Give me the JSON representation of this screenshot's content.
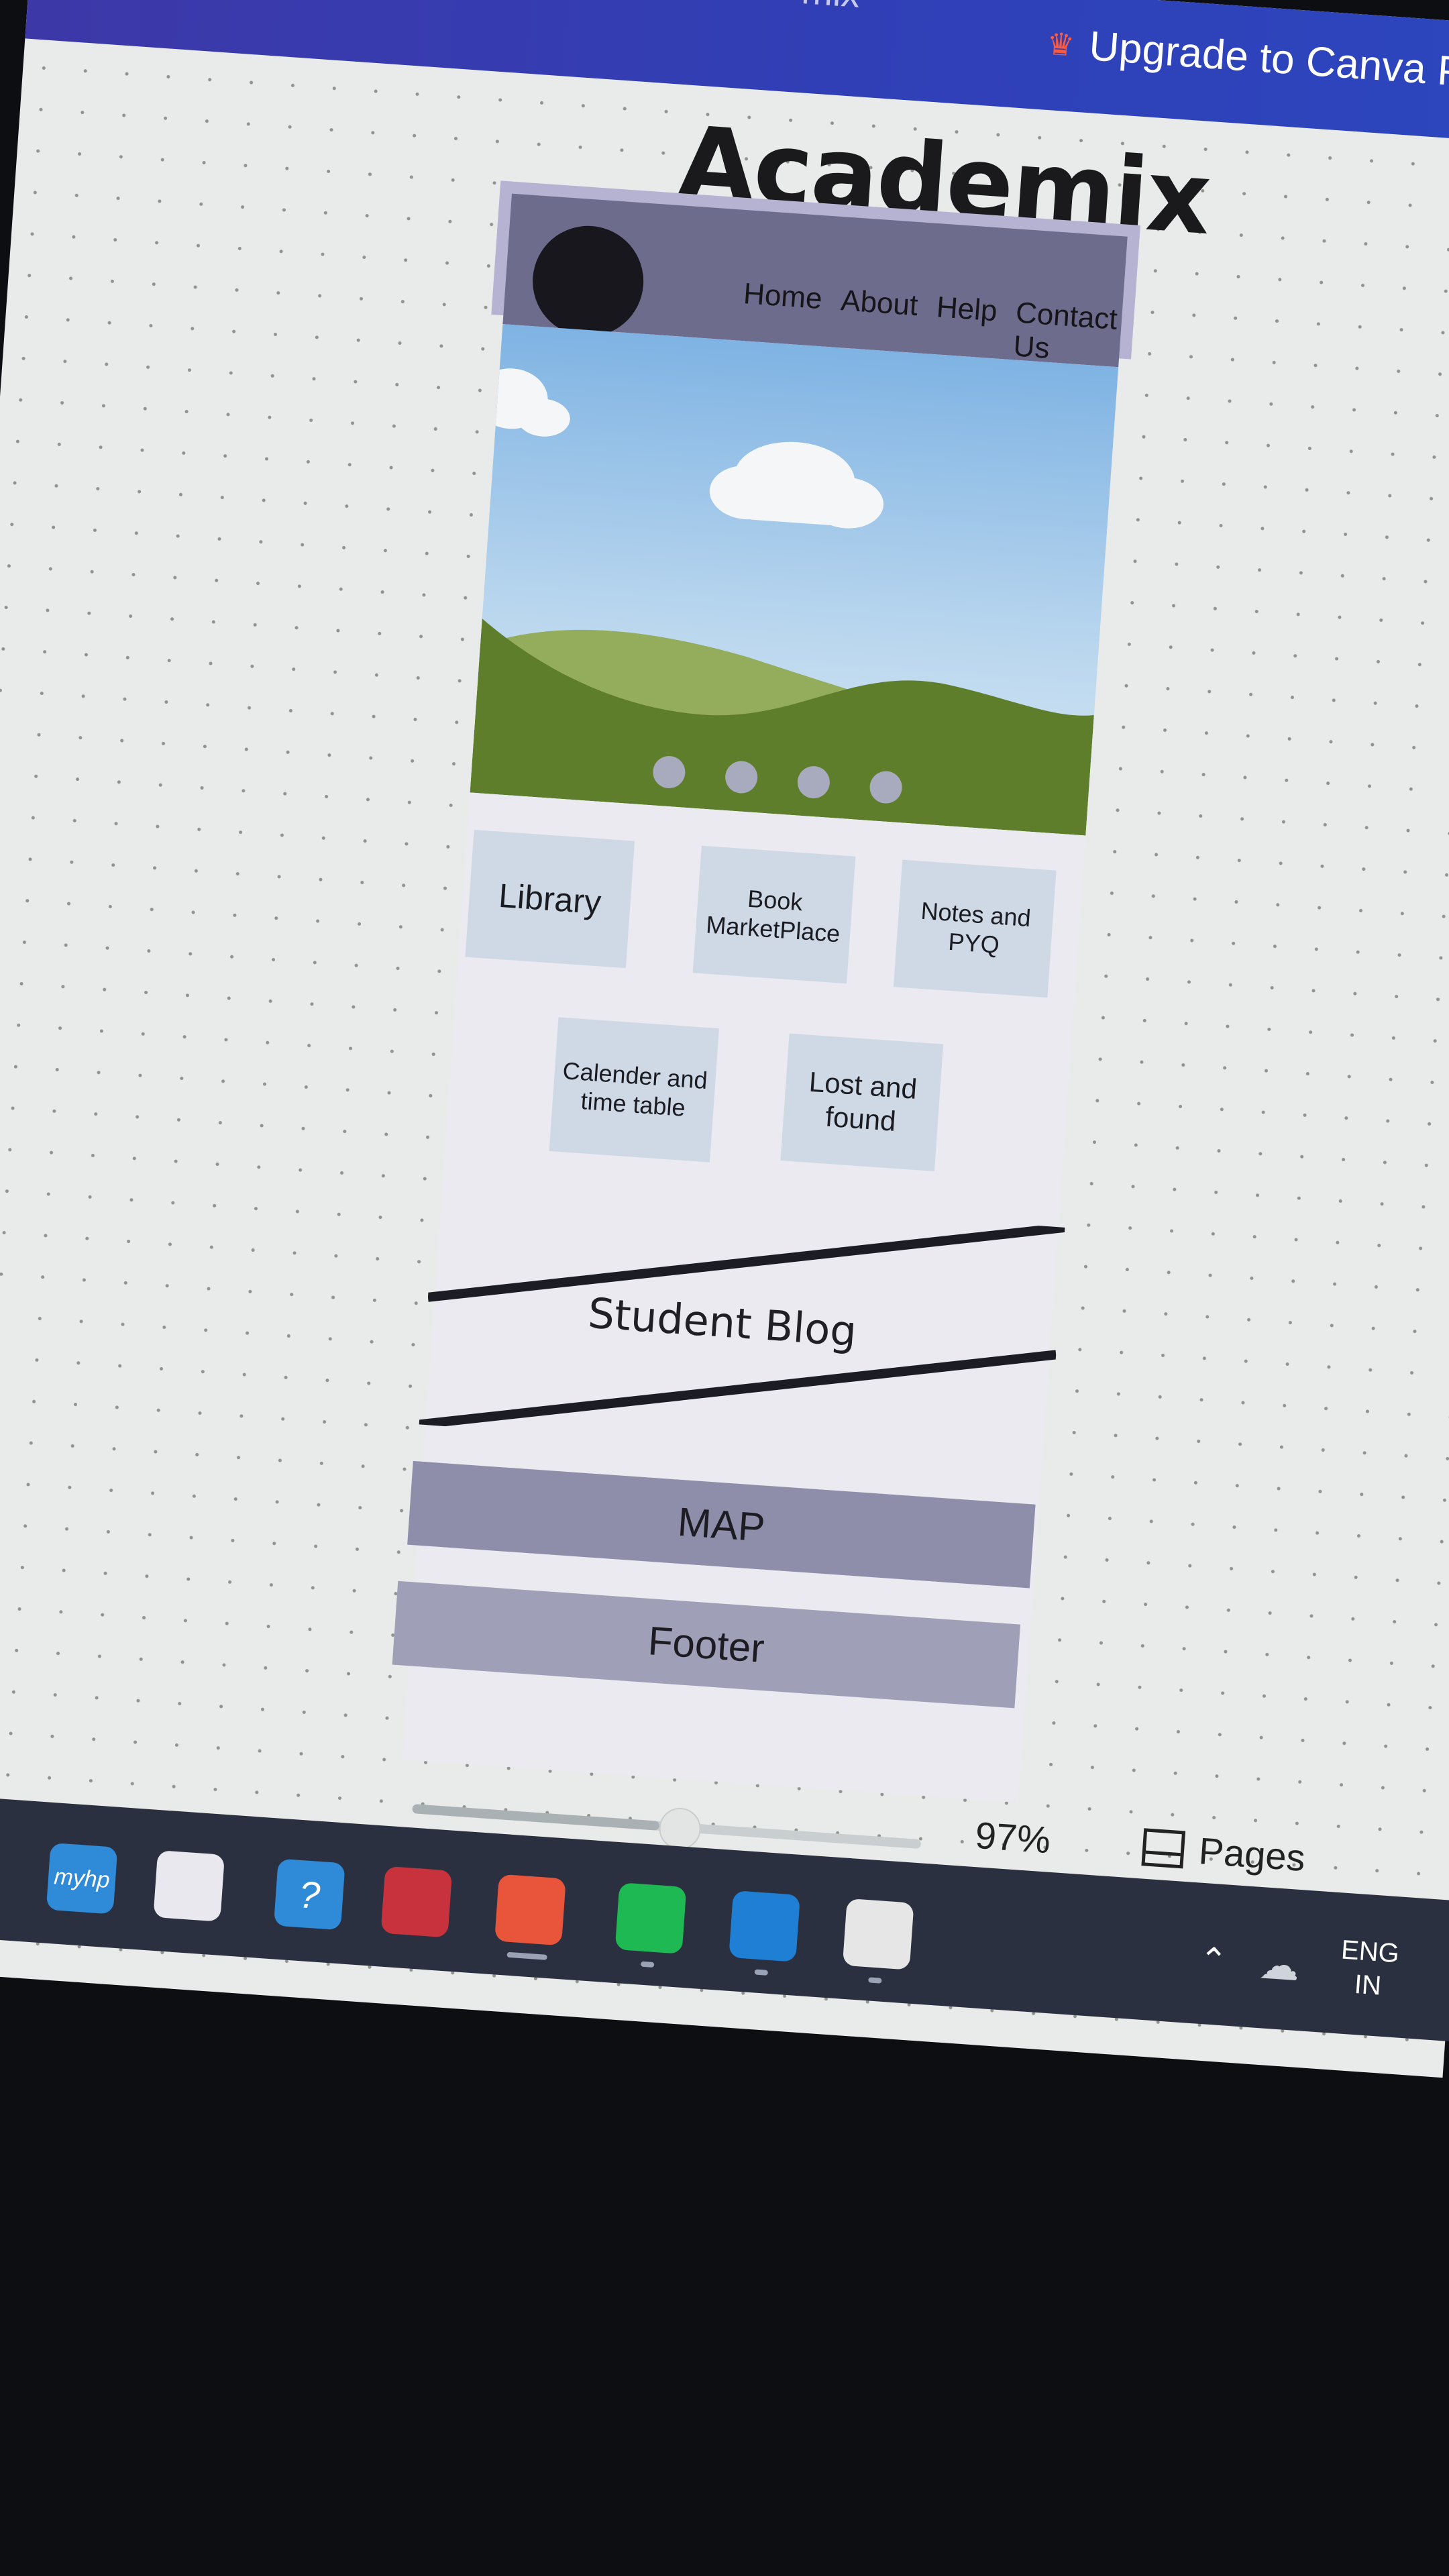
{
  "canva": {
    "window_title_fragment": "mix",
    "upgrade_label": "Upgrade to Canva Pro",
    "design_title": "Academix"
  },
  "wireframe": {
    "nav": [
      "Home",
      "About",
      "Help",
      "Contact Us"
    ],
    "hero_dots": 4,
    "tiles": {
      "library": "Library",
      "book": "Book MarketPlace",
      "notes": "Notes and PYQ",
      "calender": "Calender and time table",
      "lost": "Lost and found"
    },
    "blog": "Student Blog",
    "map": "MAP",
    "footer": "Footer"
  },
  "status": {
    "zoom": "97%",
    "zoom_fraction": 0.97,
    "pages_label": "Pages"
  },
  "taskbar": {
    "apps": [
      {
        "name": "myhp",
        "label": "myhp",
        "color": "#2f8ad8"
      },
      {
        "name": "microsoft-store-icon",
        "label": "",
        "color": "#e8e8ee"
      },
      {
        "name": "help-icon",
        "label": "?",
        "color": "#2f8ad8"
      },
      {
        "name": "mcafee-icon",
        "label": "",
        "color": "#c8323c"
      },
      {
        "name": "brave-icon",
        "label": "",
        "color": "#e8553a"
      },
      {
        "name": "spotify-icon",
        "label": "",
        "color": "#1fb954"
      },
      {
        "name": "vscode-icon",
        "label": "",
        "color": "#1f7fd4"
      },
      {
        "name": "inkscape-icon",
        "label": "",
        "color": "#e6e6e6"
      }
    ],
    "lang_line1": "ENG",
    "lang_line2": "IN"
  }
}
